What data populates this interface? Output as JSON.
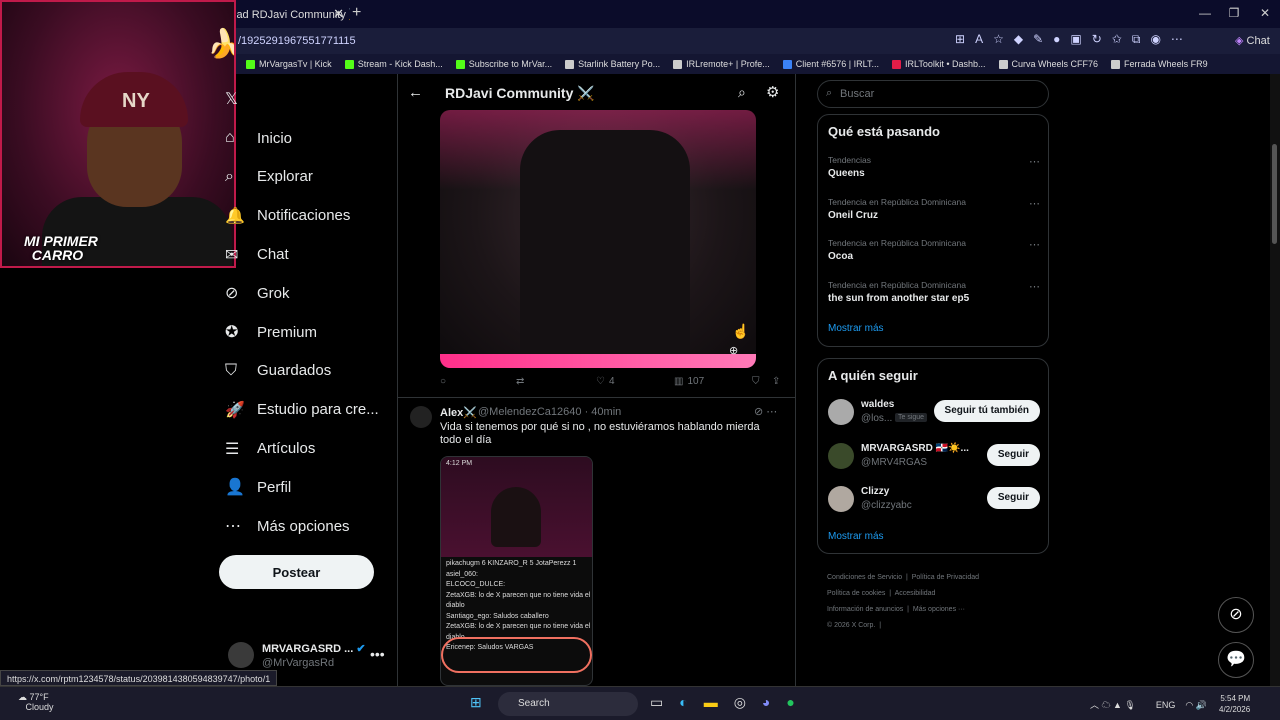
{
  "browser": {
    "tab_title": "lad RDJavi Community ⚔️",
    "url": "/1925291967551771115",
    "chat_label": "Chat",
    "new_tab": "+",
    "bookmarks": [
      {
        "label": "MrVargasTv | Kick",
        "color": "#53fc18"
      },
      {
        "label": "Stream - Kick Dash...",
        "color": "#53fc18"
      },
      {
        "label": "Subscribe to MrVar...",
        "color": "#53fc18"
      },
      {
        "label": "Starlink Battery Po...",
        "color": "#cccccc"
      },
      {
        "label": "IRLremote+ | Profe...",
        "color": "#cccccc"
      },
      {
        "label": "Client #6576 | IRLT...",
        "color": "#3b82f6"
      },
      {
        "label": "IRLToolkit • Dashb...",
        "color": "#e11d48"
      },
      {
        "label": "Curva Wheels CFF76",
        "color": "#cccccc"
      },
      {
        "label": "Ferrada Wheels FR9",
        "color": "#cccccc"
      }
    ]
  },
  "webcam": {
    "banner_line1": "MI PRIMER",
    "banner_line2": "CARRO",
    "cap_logo": "NY"
  },
  "nav": {
    "items": [
      {
        "label": "",
        "icon": "x-logo-icon"
      },
      {
        "label": "Inicio",
        "icon": "home-icon"
      },
      {
        "label": "Explorar",
        "icon": "search-icon"
      },
      {
        "label": "Notificaciones",
        "icon": "bell-icon"
      },
      {
        "label": "Chat",
        "icon": "chat-icon"
      },
      {
        "label": "Grok",
        "icon": "grok-icon"
      },
      {
        "label": "Premium",
        "icon": "premium-icon"
      },
      {
        "label": "Guardados",
        "icon": "bookmark-icon"
      },
      {
        "label": "Estudio para cre...",
        "icon": "rocket-icon"
      },
      {
        "label": "Artículos",
        "icon": "article-icon"
      },
      {
        "label": "Perfil",
        "icon": "person-icon"
      },
      {
        "label": "Más opciones",
        "icon": "more-icon"
      }
    ],
    "post_label": "Postear",
    "account": {
      "name": "MRVARGASRD ...",
      "handle": "@MrVargasRd",
      "more": "•••"
    }
  },
  "main": {
    "header_title": "RDJavi Community ⚔️",
    "tweet1_actions": {
      "replies": "",
      "retweets": "",
      "likes": "4",
      "views": "107"
    },
    "tweet2": {
      "name": "Alex⚔️",
      "handle": "@MelendezCa12640",
      "time": "· 40min",
      "text": "Vida si tenemos por qué si no , no estuviéramos hablando mierda todo el día",
      "chat_lines": [
        "4:12 PM",
        "pikachugm  6  KINZARO_R  5  JotaPerezz  1",
        "asiel_060:",
        "ELCOCO_DULCE:",
        "ZetaXGB: lo de X parecen que no tiene vida el diablo",
        "Santiago_ego: Saludos caballero",
        "ZetaXGB: lo de X parecen que no tiene vida el diablo",
        "Ericenep: Saludos VARGAS"
      ]
    },
    "status_url": "https://x.com/rptm1234578/status/2039814380594839747/photo/1"
  },
  "right": {
    "search_placeholder": "Buscar",
    "trends_title": "Qué está pasando",
    "trends": [
      {
        "context": "Tendencias",
        "name": "Queens"
      },
      {
        "context": "Tendencia en República Dominicana",
        "name": "Oneil Cruz"
      },
      {
        "context": "Tendencia en República Dominicana",
        "name": "Ocoa"
      },
      {
        "context": "Tendencia en República Dominicana",
        "name": "the sun from another star ep5"
      }
    ],
    "show_more": "Mostrar más",
    "follow_title": "A quién seguir",
    "follow": [
      {
        "name": "waldes",
        "handle": "@los...",
        "badge": "Te sigue",
        "button": "Seguir tú también"
      },
      {
        "name": "MRVARGASRD 🇩🇴☀️...",
        "handle": "@MRV4RGAS",
        "badge": "",
        "button": "Seguir"
      },
      {
        "name": "Clizzy",
        "handle": "@clizzyabc",
        "badge": "",
        "button": "Seguir"
      }
    ],
    "follow_more": "Mostrar más",
    "footer": [
      "Condiciones de Servicio",
      "Política de Privacidad",
      "Política de cookies",
      "Accesibilidad",
      "Información de anuncios",
      "Más opciones ···",
      "© 2026 X Corp."
    ]
  },
  "taskbar": {
    "weather_temp": "77°F",
    "weather_desc": "Cloudy",
    "search_label": "Search",
    "lang": "ENG",
    "time": "5:54 PM",
    "date": "4/2/2026"
  }
}
